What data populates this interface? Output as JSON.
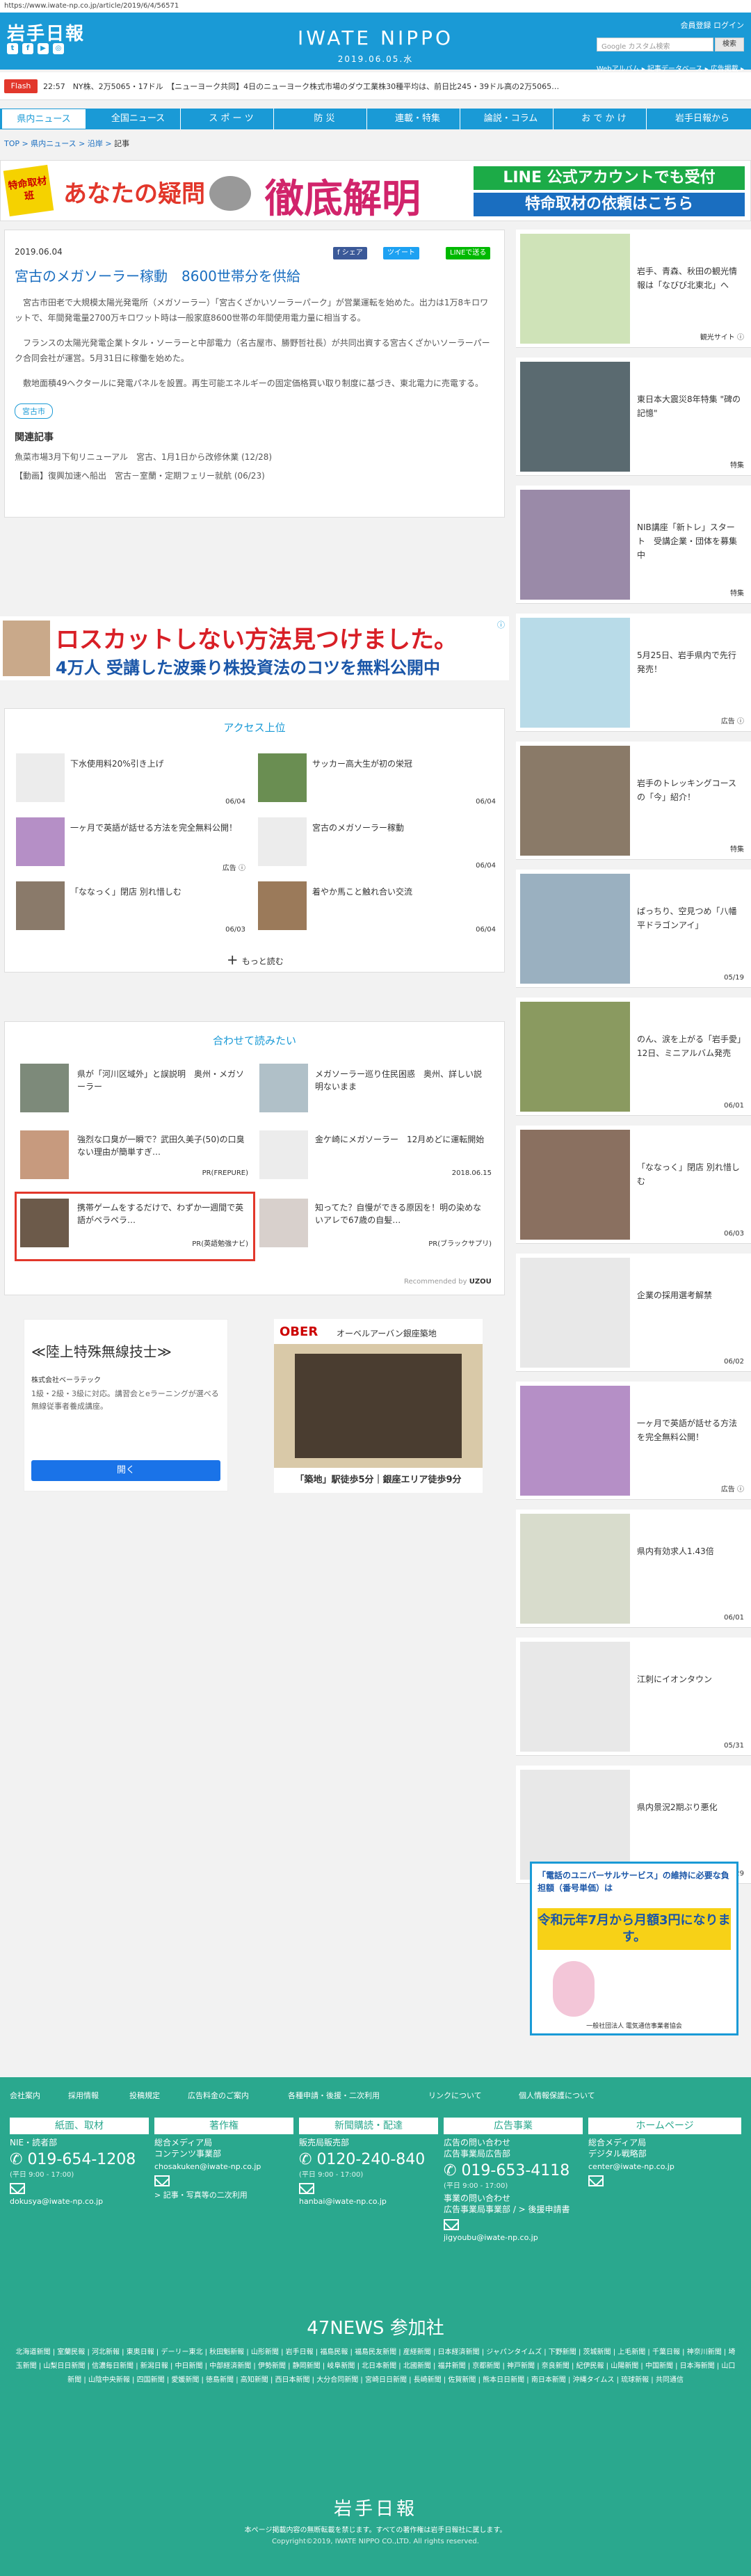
{
  "browser": {
    "url": "https://www.iwate-np.co.jp/article/2019/6/4/56571"
  },
  "header": {
    "logo_left": "岩手日報",
    "logo_center": "IWATE NIPPO",
    "date": "2019.06.05.水",
    "links": "会員登録 ログイン",
    "search_placeholder": "Google カスタム検索",
    "search_button": "検索",
    "sub_links": "Webアルバム ▸ 記事データベース ▸ 広告掲載 ▸",
    "social": [
      "t",
      "f",
      "▶",
      "◎"
    ]
  },
  "ticker": {
    "badge": "Flash",
    "time": "22:57",
    "text": "NY株、2万5065・17ドル　【ニューヨーク共同】4日のニューヨーク株式市場のダウ工業株30種平均は、前日比245・39ドル高の2万5065…"
  },
  "nav": [
    "県内ニュース",
    "全国ニュース",
    "ス ポ ー ツ",
    "防 災",
    "連載・特集",
    "論説・コラム",
    "お で か け",
    "岩手日報から"
  ],
  "breadcrumb": {
    "items": [
      "TOP",
      "県内ニュース",
      "沿岸"
    ],
    "current": "記事"
  },
  "banner": {
    "left": "特命取材班",
    "middle": "あなたの疑問",
    "big": "徹底解明",
    "right1": "LINE 公式アカウントでも受付",
    "right2": "特命取材の依頼はこちら"
  },
  "article": {
    "date": "2019.06.04",
    "share": [
      "f シェア",
      "ツイート",
      "LINEで送る"
    ],
    "title": "宮古のメガソーラー稼動　8600世帯分を供給",
    "paras": [
      "宮古市田老で大規模太陽光発電所（メガソーラー）「宮古くざかいソーラーパーク」が営業運転を始めた。出力は1万8キロワットで、年間発電量2700万キロワット時は一般家庭8600世帯の年間使用電力量に相当する。",
      "フランスの太陽光発電企業トタル・ソーラーと中部電力（名古屋市、勝野哲社長）が共同出資する宮古くざかいソーラーパーク合同会社が運営。5月31日に稼働を始めた。",
      "敷地面積49ヘクタールに発電パネルを設置。再生可能エネルギーの固定価格買い取り制度に基づき、東北電力に売電する。"
    ],
    "tag": "宮古市",
    "related_title": "関連記事",
    "related": [
      "魚菜市場3月下旬リニューアル　宮古、1月1日から改修休業 (12/28)",
      "【動画】復興加速へ船出　宮古－室蘭・定期フェリー就航 (06/23)"
    ]
  },
  "ad_mid": {
    "title": "ロスカットしない方法見つけました。",
    "sub": "4万人 受講した波乗り株投資法のコツを無料公開中",
    "tag": "ⓘ"
  },
  "ranking": {
    "title": "アクセス上位",
    "items": [
      {
        "text": "下水使用料20%引き上げ",
        "date": "06/04"
      },
      {
        "text": "サッカー高大生が初の栄冠",
        "date": "06/04"
      },
      {
        "text": "一ヶ月で英語が話せる方法を完全無料公開！",
        "date": "広告 ⓘ"
      },
      {
        "text": "宮古のメガソーラー稼動",
        "date": "06/04"
      },
      {
        "text": "「ななっく」閉店 別れ惜しむ",
        "date": "06/03"
      },
      {
        "text": "着やか馬こと触れ合い交流",
        "date": "06/04"
      }
    ],
    "more": "もっと読む"
  },
  "related2": {
    "title": "合わせて読みたい",
    "items": [
      {
        "text": "県が「河川区域外」と誤説明　奥州・メガソーラー",
        "source": ""
      },
      {
        "text": "メガソーラー巡り住民困惑　奥州、詳しい説明ないまま",
        "source": ""
      },
      {
        "text": "強烈な口臭が一瞬で？武田久美子(50)の口臭ない理由が簡単すぎ…",
        "source": "PR(FREPURE)"
      },
      {
        "text": "金ケ崎にメガソーラー　12月めどに運転開始",
        "source": "2018.06.15"
      },
      {
        "text": "携帯ゲームをするだけで、わずか一週間で英語がペラペラ…",
        "source": "PR(英語勉強ナビ)"
      },
      {
        "text": "知ってた？自慢ができる原因を！明の染めないアレで67歳の自髪…",
        "source": "PR(ブラックサプリ)"
      }
    ],
    "recommended": "Recommended by"
  },
  "ad_bottom_left": {
    "title": "≪陸上特殊無線技士≫",
    "company": "株式会社ベーラテック",
    "desc": "1級・2級・3級に対応。講習会とeラーニングが選べる無線従事者養成講座。",
    "button": "開く"
  },
  "ad_bottom_right": {
    "brand": "OBER",
    "text": "オーベルアーバン銀座築地",
    "line": "「築地」駅徒歩5分｜銀座エリア徒歩9分"
  },
  "sidebar": [
    {
      "text": "岩手、青森、秋田の観光情報は「なびび北東北」へ",
      "date": "観光サイト ⓘ"
    },
    {
      "text": "東日本大震災8年特集 \"碑の記憶\"",
      "date": "特集"
    },
    {
      "text": "NIB講座「新トレ」スタート　受講企業・団体を募集中",
      "date": "特集"
    },
    {
      "text": "5月25日、岩手県内で先行発売！",
      "date": "広告 ⓘ"
    },
    {
      "text": "岩手のトレッキングコースの「今」紹介！",
      "date": "特集"
    },
    {
      "text": "ぱっちり、空見つめ「八幡平ドラゴンアイ」",
      "date": "05/19"
    },
    {
      "text": "のん、涙を上がる「岩手愛」　12日、ミニアルバム発売",
      "date": "06/01"
    },
    {
      "text": "「ななっく」閉店 別れ惜しむ",
      "date": "06/03"
    },
    {
      "text": "企業の採用選考解禁",
      "date": "06/02"
    },
    {
      "text": "一ヶ月で英語が話せる方法を完全無料公開！",
      "date": "広告 ⓘ"
    },
    {
      "text": "県内有効求人1.43倍",
      "date": "06/01"
    },
    {
      "text": "江刺にイオンタウン",
      "date": "05/31"
    },
    {
      "text": "県内景況2期ぶり悪化",
      "date": "05/29"
    }
  ],
  "side_ad": {
    "line1": "「電話のユニバーサルサービス」の維持に必要な負担額（番号単価）は",
    "line2": "令和元年7月から月額3円になります。",
    "foot": "一般社団法人 電気通信事業者協会"
  },
  "footer": {
    "links": [
      "会社案内",
      "採用情報",
      "投稿規定",
      "広告料金のご案内",
      "各種申請・後援・二次利用",
      "リンクについて",
      "個人情報保護について"
    ],
    "cols": [
      {
        "head": "紙面、取材",
        "t": "NIE・読者部",
        "tel": "019-654-1208",
        "hours": "(平日 9:00 - 17:00)",
        "mail": "dokusya@iwate-np.co.jp",
        "extra": ""
      },
      {
        "head": "著作権",
        "t": "総合メディア局\nコンテンツ事業部",
        "tel": "",
        "hours": "",
        "mail": "chosakuken@iwate-np.co.jp",
        "extra": "> 記事・写真等の二次利用"
      },
      {
        "head": "新聞購読・配達",
        "t": "販売局販売部",
        "tel": "0120-240-840",
        "hours": "(平日 9:00 - 17:00)",
        "mail": "hanbai@iwate-np.co.jp",
        "extra": ""
      },
      {
        "head": "広告事業",
        "t": "広告の問い合わせ\n広告事業局広告部",
        "tel": "019-653-4118",
        "hours": "(平日 9:00 - 17:00)",
        "mail": "jigyoubu@iwate-np.co.jp",
        "extra": "事業の問い合わせ\n広告事業局事業部 / > 後援申請書"
      },
      {
        "head": "ホームページ",
        "t": "総合メディア局\nデジタル戦略部",
        "tel": "",
        "hours": "",
        "mail": "center@iwate-np.co.jp",
        "extra": ""
      }
    ],
    "news47_title": "47NEWS 参加社",
    "news47": "北海道新聞 | 室蘭民報 | 河北新報 | 東奥日報 | デーリー東北 | 秋田魁新報 | 山形新聞 | 岩手日報 | 福島民報 | 福島民友新聞 | 産経新聞 | 日本経済新聞 | ジャパンタイムズ | 下野新聞 | 茨城新聞 | 上毛新聞 | 千葉日報 | 神奈川新聞 | 埼玉新聞 | 山梨日日新聞 | 信濃毎日新聞 | 新潟日報 | 中日新聞 | 中部経済新聞 | 伊勢新聞 | 静岡新聞 | 岐阜新聞 | 北日本新聞 | 北國新聞 | 福井新聞 | 京都新聞 | 神戸新聞 | 奈良新聞 | 紀伊民報 | 山陽新聞 | 中国新聞 | 日本海新聞 | 山口新聞 | 山陰中央新報 | 四国新聞 | 愛媛新聞 | 徳島新聞 | 高知新聞 | 西日本新聞 | 大分合同新聞 | 宮崎日日新聞 | 長崎新聞 | 佐賀新聞 | 熊本日日新聞 | 南日本新聞 | 沖縄タイムス | 琉球新報 | 共同通信",
    "logo": "岩手日報",
    "note": "本ページ掲載内容の無断転載を禁じます。すべての著作権は岩手日報社に属します。",
    "copyright": "Copyright©2019, IWATE NIPPO CO.,LTD. All rights reserved."
  }
}
